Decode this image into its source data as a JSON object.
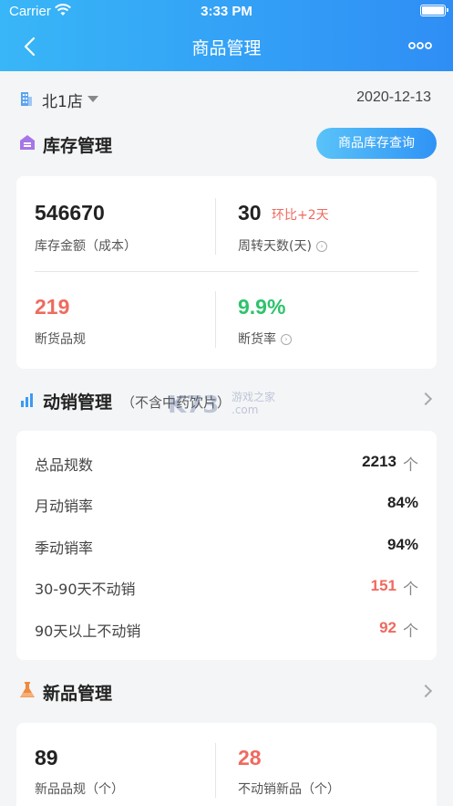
{
  "status_bar": {
    "carrier": "Carrier",
    "time": "3:33 PM"
  },
  "nav": {
    "title": "商品管理",
    "back_icon": "back-arrow-icon",
    "more_icon": "more-dots-icon"
  },
  "store": {
    "name": "北1店",
    "date": "2020-12-13"
  },
  "inventory": {
    "title": "库存管理",
    "query_button": "商品库存查询",
    "stats": [
      {
        "value": "546670",
        "label": "库存金额（成本）"
      },
      {
        "value": "30",
        "extra": "环比+2天",
        "label": "周转天数(天)"
      },
      {
        "value": "219",
        "label": "断货品规"
      },
      {
        "value": "9.9%",
        "label": "断货率"
      }
    ]
  },
  "sales": {
    "title": "动销管理",
    "subtitle": "（不含中药饮片）",
    "rows": [
      {
        "label": "总品规数",
        "value": "2213",
        "unit": "个"
      },
      {
        "label": "月动销率",
        "value": "84%",
        "unit": ""
      },
      {
        "label": "季动销率",
        "value": "94%",
        "unit": ""
      },
      {
        "label": "30-90天不动销",
        "value": "151",
        "unit": "个"
      },
      {
        "label": "90天以上不动销",
        "value": "92",
        "unit": "个"
      }
    ]
  },
  "new_products": {
    "title": "新品管理",
    "stats": [
      {
        "value": "89",
        "label": "新品品规（个）"
      },
      {
        "value": "28",
        "label": "不动销新品（个）"
      }
    ]
  },
  "watermark": {
    "text": "游戏之家",
    "brand": "K73",
    "suffix": ".com"
  },
  "colors": {
    "header_start": "#38b6f7",
    "header_end": "#2f8ef5",
    "red": "#ef6a5f",
    "green": "#2ec36c"
  }
}
